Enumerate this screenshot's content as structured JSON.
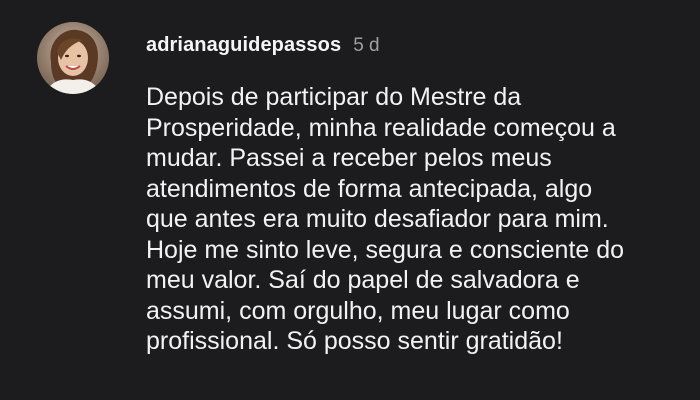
{
  "comment": {
    "username": "adrianaguidepassos",
    "time": "5 d",
    "lines": [
      "Depois de participar do Mestre da",
      "Prosperidade, minha realidade começou a",
      "mudar. Passei a receber pelos meus",
      "atendimentos de forma antecipada, algo",
      "que antes era muito desafiador para mim.",
      "Hoje me sinto leve, segura e consciente do",
      "meu valor. Saí do papel de salvadora e",
      "assumi, com orgulho, meu lugar como",
      "profissional. Só posso sentir gratidão!"
    ],
    "avatar_icon": "profile-photo"
  },
  "colors": {
    "background": "#1c1c1e",
    "text": "#f2f2f2",
    "muted": "#a0a0a0"
  }
}
